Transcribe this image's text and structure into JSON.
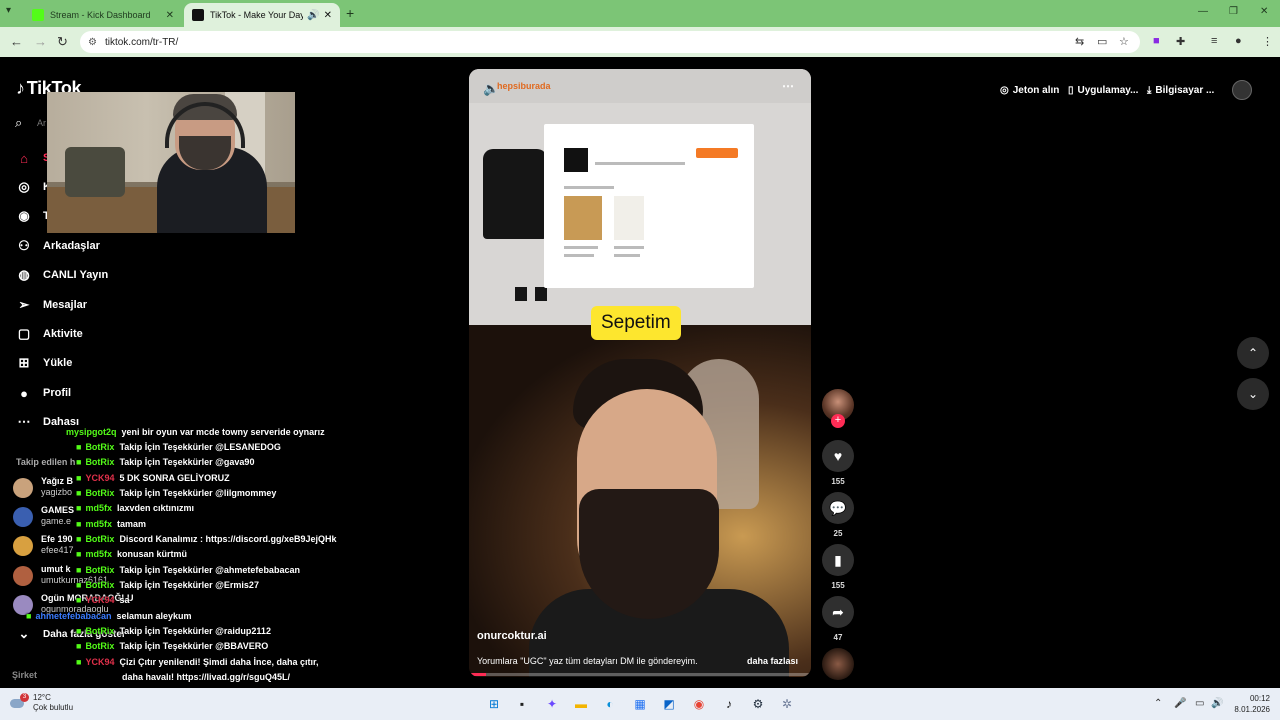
{
  "browser": {
    "tabs": [
      {
        "title": "Stream - Kick Dashboard",
        "active": false,
        "favicon_color": "#53fc18"
      },
      {
        "title": "TikTok - Make Your Day",
        "active": true,
        "favicon_color": "#111111"
      }
    ],
    "url": "tiktok.com/tr-TR/"
  },
  "sidebar": {
    "logo": "TikTok",
    "search_placeholder": "Ar",
    "items": [
      {
        "label": "S",
        "icon": "home-icon"
      },
      {
        "label": "K",
        "icon": "compass-icon"
      },
      {
        "label": "T",
        "icon": "following-avatar-icon"
      },
      {
        "label": "Arkadaşlar",
        "icon": "friends-icon"
      },
      {
        "label": "CANLI Yayın",
        "icon": "live-icon"
      },
      {
        "label": "Mesajlar",
        "icon": "messages-icon"
      },
      {
        "label": "Aktivite",
        "icon": "activity-icon"
      },
      {
        "label": "Yükle",
        "icon": "upload-icon"
      },
      {
        "label": "Profil",
        "icon": "profile-icon"
      },
      {
        "label": "Dahası",
        "icon": "more-icon"
      }
    ],
    "following_title": "Takip edilen h",
    "following": [
      {
        "name": "Yağız B",
        "handle": "yagizbo",
        "color": "#c9a27c"
      },
      {
        "name": "GAMES",
        "handle": "game.e",
        "color": "#3a5fb0"
      },
      {
        "name": "Efe 190",
        "handle": "efee417",
        "color": "#d8a040"
      },
      {
        "name": "umut k",
        "handle": "umutkurnaz6161",
        "color": "#b06040"
      },
      {
        "name": "Ogün MORADAOĞLU",
        "handle": "ogunmoradaoglu",
        "color": "#9a8ac0"
      }
    ],
    "see_more": "Daha fazla göster",
    "company": "Şirket"
  },
  "chat": [
    {
      "user": "mysipgot2q",
      "color": "#53fc18",
      "msg": "yeni bir oyun var mcde towny serveride oynarız",
      "badge": false
    },
    {
      "user": "BotRix",
      "color": "#53fc18",
      "msg": "Takip İçin Teşekkürler @LESANEDOG",
      "badge": true
    },
    {
      "user": "BotRix",
      "color": "#53fc18",
      "msg": "Takip İçin Teşekkürler @gava90",
      "badge": true
    },
    {
      "user": "YCK94",
      "color": "#e0304a",
      "msg": "5 DK SONRA GELİYORUZ",
      "badge": true
    },
    {
      "user": "BotRix",
      "color": "#53fc18",
      "msg": "Takip İçin Teşekkürler @lilgmommey",
      "badge": true
    },
    {
      "user": "md5fx",
      "color": "#53fc18",
      "msg": "laxvden cıktınızmı",
      "badge": true
    },
    {
      "user": "md5fx",
      "color": "#53fc18",
      "msg": "tamam",
      "badge": true
    },
    {
      "user": "BotRix",
      "color": "#53fc18",
      "msg": "Discord Kanalımız : https://discord.gg/xeB9JejQHk",
      "badge": true
    },
    {
      "user": "md5fx",
      "color": "#53fc18",
      "msg": "konusan kürtmü",
      "badge": true
    },
    {
      "user": "BotRix",
      "color": "#53fc18",
      "msg": "Takip İçin Teşekkürler @ahmetefebabacan",
      "badge": true
    },
    {
      "user": "BotRix",
      "color": "#53fc18",
      "msg": "Takip İçin Teşekkürler @Ermis27",
      "badge": true
    },
    {
      "user": "YCK94",
      "color": "#e0304a",
      "msg": "sa",
      "badge": true
    },
    {
      "user": "ahmetefebabacan",
      "color": "#3a7bff",
      "msg": "selamun aleykum",
      "badge": true
    },
    {
      "user": "BotRix",
      "color": "#53fc18",
      "msg": "Takip İçin Teşekkürler @raidup2112",
      "badge": true
    },
    {
      "user": "BotRix",
      "color": "#53fc18",
      "msg": "Takip İçin Teşekkürler @BBAVERO",
      "badge": true
    },
    {
      "user": "YCK94",
      "color": "#e0304a",
      "msg": "Çizi Çıtır yenilendi! Şimdi daha İnce, daha çıtır,",
      "badge": true
    },
    {
      "user": "",
      "color": "#ffffff",
      "msg": "daha havalı! https://livad.gg/r/sguQ45L/",
      "badge": false
    }
  ],
  "video": {
    "site_brand": "hepsiburada",
    "caption": "Sepetim",
    "author": "onurcoktur.ai",
    "description": "Yorumlara \"UGC\" yaz tüm detayları DM ile göndereyim.",
    "more": "daha fazlası",
    "progress": 0.05
  },
  "actions": {
    "likes": "155",
    "comments": "25",
    "saves": "155",
    "shares": "47"
  },
  "header": {
    "coins": "Jeton alın",
    "app": "Uygulamay...",
    "desktop": "Bilgisayar ..."
  },
  "taskbar": {
    "temp": "12°C",
    "weather": "Çok bulutlu",
    "weather_badge": "3",
    "time": "00:12",
    "date": "8.01.2026"
  },
  "colors": {
    "accent": "#fe2c55",
    "kick": "#53fc18",
    "browser_tab": "#7cc576"
  }
}
